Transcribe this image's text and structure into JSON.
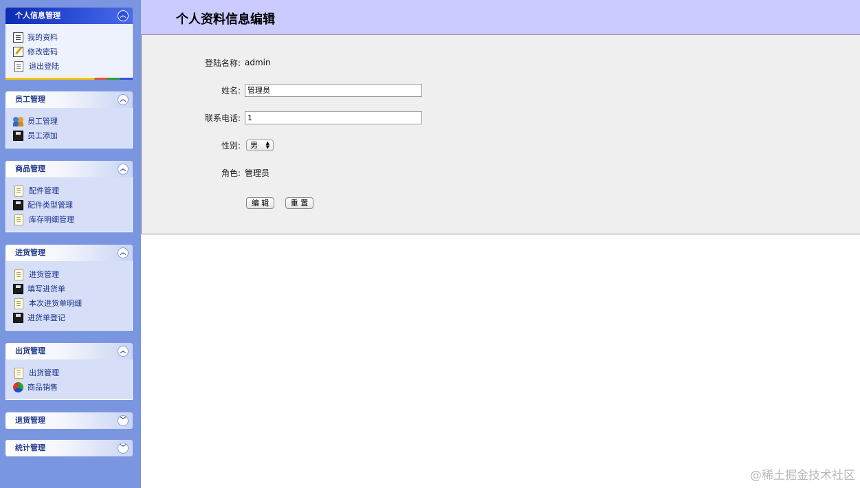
{
  "sidebar": {
    "panels": [
      {
        "title": "个人信息管理",
        "toggle": "⌃",
        "items": [
          {
            "label": "我的资料",
            "icon": "edit-profile-icon"
          },
          {
            "label": "修改密码",
            "icon": "pencil-icon"
          },
          {
            "label": "退出登陆",
            "icon": "page-icon"
          }
        ]
      },
      {
        "title": "员工管理",
        "toggle": "⌃",
        "items": [
          {
            "label": "员工管理",
            "icon": "people-icon"
          },
          {
            "label": "员工添加",
            "icon": "disk-icon"
          }
        ]
      },
      {
        "title": "商品管理",
        "toggle": "⌃",
        "items": [
          {
            "label": "配件管理",
            "icon": "document-icon"
          },
          {
            "label": "配件类型管理",
            "icon": "disk-icon"
          },
          {
            "label": "库存明细管理",
            "icon": "document-icon"
          }
        ]
      },
      {
        "title": "进货管理",
        "toggle": "⌃",
        "items": [
          {
            "label": "进货管理",
            "icon": "document-icon"
          },
          {
            "label": "填写进货单",
            "icon": "disk-icon"
          },
          {
            "label": "本次进货单明细",
            "icon": "document-icon"
          },
          {
            "label": "进货单登记",
            "icon": "disk-icon"
          }
        ]
      },
      {
        "title": "出货管理",
        "toggle": "⌃",
        "items": [
          {
            "label": "出货管理",
            "icon": "document-icon"
          },
          {
            "label": "商品销售",
            "icon": "globe-icon"
          }
        ]
      },
      {
        "title": "退货管理",
        "toggle": "⌄"
      },
      {
        "title": "统计管理",
        "toggle": "⌄"
      }
    ]
  },
  "header": {
    "title": "个人资料信息编辑"
  },
  "form": {
    "login_label": "登陆名称:",
    "login_value": "admin",
    "name_label": "姓名:",
    "name_value": "管理员",
    "phone_label": "联系电话:",
    "phone_value": "1",
    "gender_label": "性别:",
    "gender_value": "男",
    "role_label": "角色:",
    "role_value": "管理员",
    "edit_button": "编 辑",
    "reset_button": "重 置"
  },
  "watermark": "@稀土掘金技术社区"
}
